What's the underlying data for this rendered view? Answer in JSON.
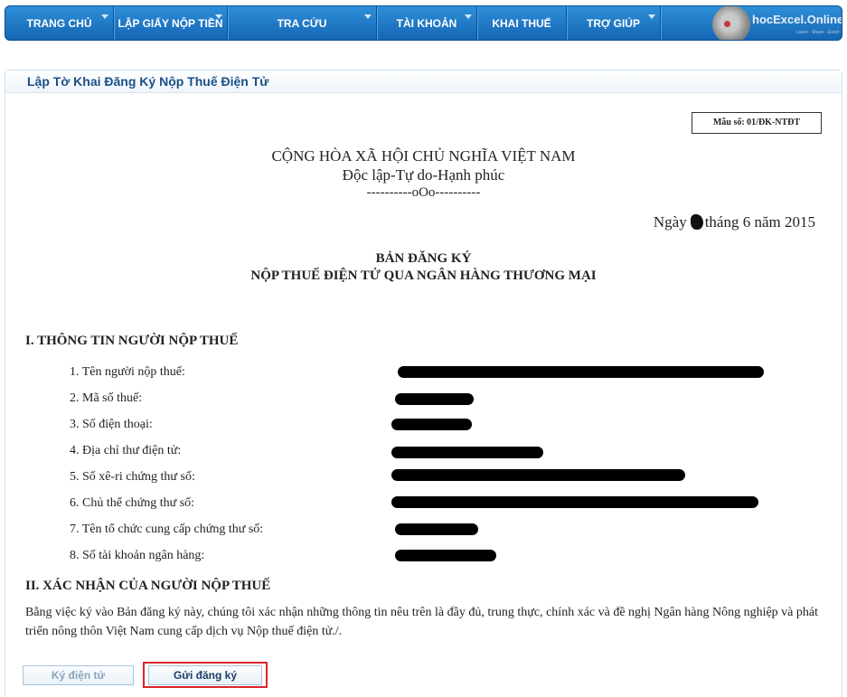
{
  "nav": {
    "items": [
      {
        "label": "TRANG CHỦ",
        "dropdown": true
      },
      {
        "label": "LẬP GIẤY NỘP TIỀN",
        "dropdown": true
      },
      {
        "label": "TRA CỨU",
        "dropdown": true
      },
      {
        "label": "TÀI KHOẢN",
        "dropdown": true
      },
      {
        "label": "KHAI THUẾ",
        "dropdown": false
      },
      {
        "label": "TRỢ GIÚP",
        "dropdown": true
      }
    ],
    "logo_text": "hocExcel.Online",
    "logo_sub": "Learn - Share - Excel"
  },
  "panel": {
    "title": "Lập Tờ Khai Đăng Ký Nộp Thuế Điện Tử"
  },
  "form": {
    "form_code": "Mẫu số: 01/ĐK-NTĐT",
    "nation": "CỘNG HÒA XÃ HỘI CHỦ NGHĨA VIỆT NAM",
    "motto": "Độc lập-Tự do-Hạnh phúc",
    "separator": "----------oOo----------",
    "date_prefix": "Ngày",
    "date_suffix": "tháng 6 năm 2015",
    "doc_title_1": "BẢN ĐĂNG KÝ",
    "doc_title_2": "NỘP THUẾ ĐIỆN TỬ QUA NGÂN HÀNG THƯƠNG MẠI",
    "section1_title": "I. THÔNG TIN NGƯỜI NỘP THUẾ",
    "fields": [
      "1. Tên người nộp thuế:",
      "2. Mã số thuế:",
      "3. Số điện thoại:",
      "4. Địa chỉ thư điện tử:",
      "5. Số xê-ri chứng thư số:",
      "6. Chủ thể chứng thư số:",
      "7. Tên tổ chức cung cấp chứng thư số:",
      "8. Số tài khoản ngân hàng:"
    ],
    "section2_title": "II. XÁC NHẬN CỦA NGƯỜI NỘP THUẾ",
    "confirm_text": "Bằng việc ký vào Bản đăng ký này, chúng tôi xác nhận những thông tin nêu trên là đầy đủ, trung thực, chính xác và đề nghị Ngân hàng Nông nghiệp và phát triển nông thôn Việt Nam cung cấp dịch vụ Nộp thuế điện tử./."
  },
  "buttons": {
    "sign": "Ký điện tử",
    "submit": "Gửi đăng ký"
  },
  "colors": {
    "nav": "#1a74c4",
    "header_text": "#1b4f86",
    "highlight": "#d9252a"
  }
}
